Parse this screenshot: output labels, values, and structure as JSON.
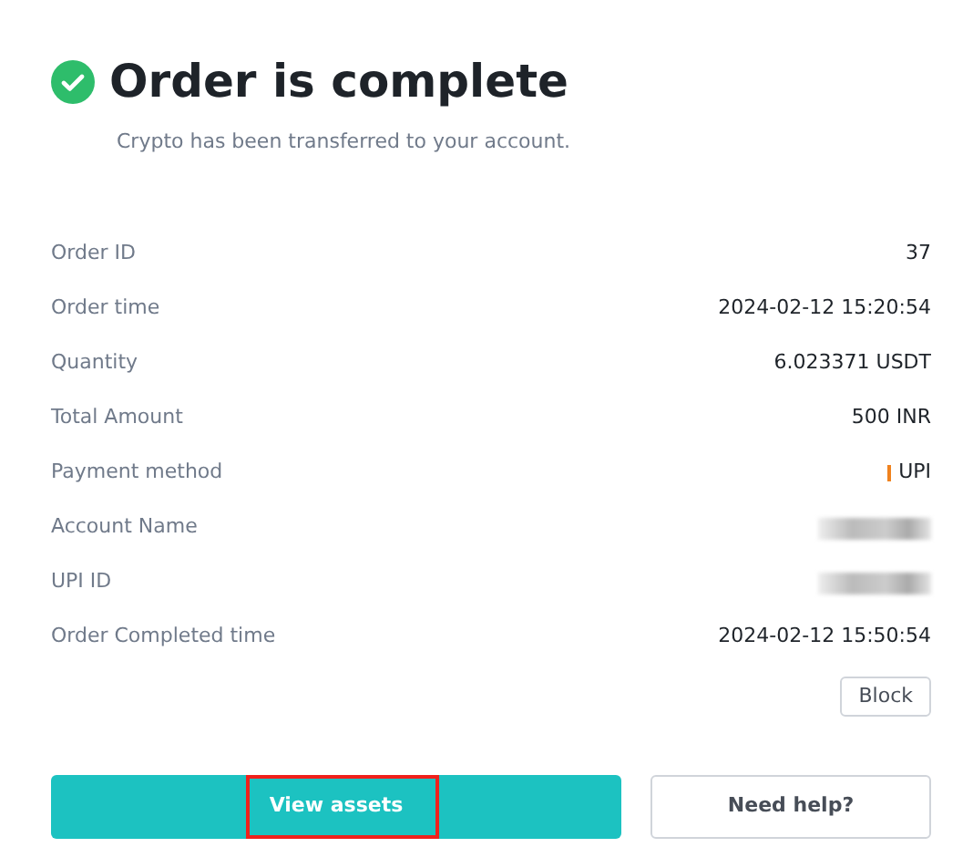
{
  "header": {
    "title": "Order is complete",
    "subtitle": "Crypto has been transferred to your account."
  },
  "details": [
    {
      "label": "Order ID",
      "kind": "text",
      "value": "37"
    },
    {
      "label": "Order time",
      "kind": "text",
      "value": "2024-02-12 15:20:54"
    },
    {
      "label": "Quantity",
      "kind": "text",
      "value": "6.023371 USDT"
    },
    {
      "label": "Total Amount",
      "kind": "text",
      "value": "500 INR"
    },
    {
      "label": "Payment method",
      "kind": "method",
      "value": "UPI"
    },
    {
      "label": "Account Name",
      "kind": "redacted"
    },
    {
      "label": "UPI ID",
      "kind": "redacted"
    },
    {
      "label": "Order Completed time",
      "kind": "text",
      "value": "2024-02-12 15:50:54"
    }
  ],
  "block_button": "Block",
  "actions": [
    {
      "label": "View assets",
      "kind": "primary",
      "highlighted": true
    },
    {
      "label": "Need help?",
      "kind": "outline",
      "highlighted": false
    }
  ]
}
